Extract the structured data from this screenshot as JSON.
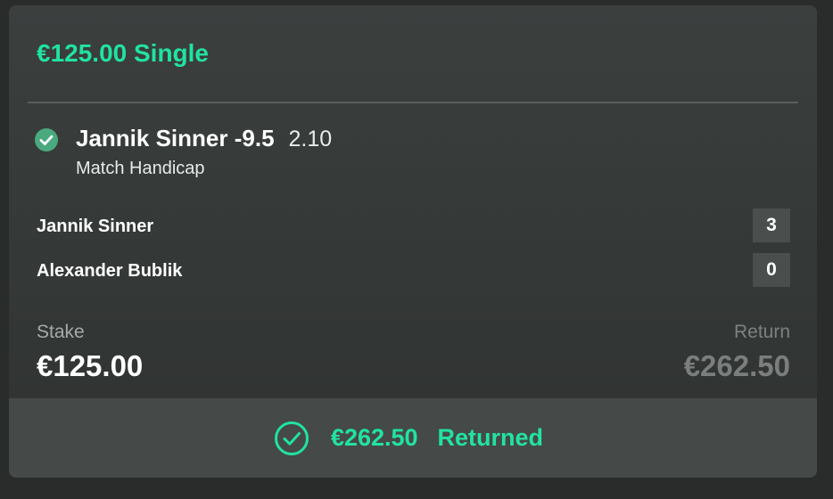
{
  "bet": {
    "title": "€125.00 Single",
    "selection": {
      "name": "Jannik Sinner -9.5",
      "odds": "2.10",
      "market": "Match Handicap",
      "status_icon": "check-circle-icon"
    },
    "players": [
      {
        "name": "Jannik Sinner",
        "score": "3"
      },
      {
        "name": "Alexander Bublik",
        "score": "0"
      }
    ],
    "stake_label": "Stake",
    "stake_value": "€125.00",
    "return_label": "Return",
    "return_value": "€262.50"
  },
  "footer": {
    "icon": "check-circle-outline-icon",
    "amount": "€262.50",
    "status": "Returned"
  },
  "colors": {
    "accent": "#21e3a0",
    "win_check": "#4aa97f",
    "card_bg": "#3b3f3e",
    "footer_bg": "#454948"
  }
}
